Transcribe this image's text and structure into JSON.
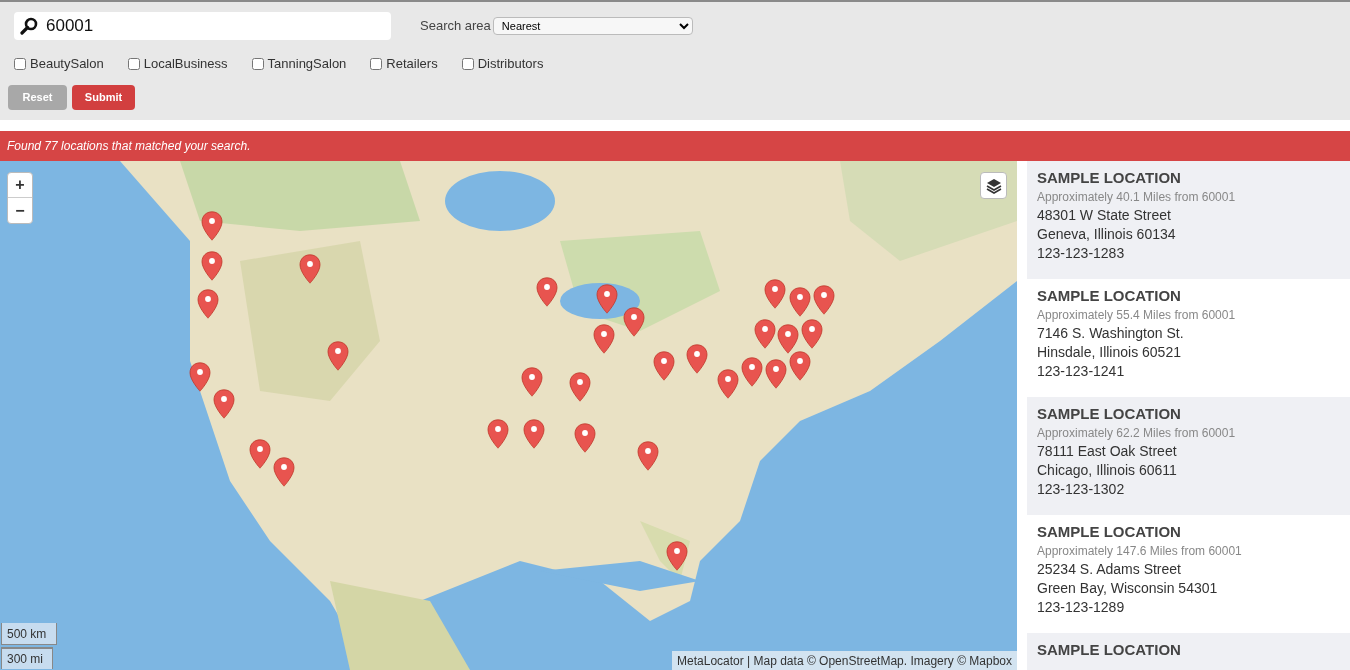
{
  "search": {
    "value": "60001"
  },
  "search_area": {
    "label": "Search area",
    "value": "Nearest"
  },
  "categories": [
    {
      "label": "BeautySalon",
      "checked": false
    },
    {
      "label": "LocalBusiness",
      "checked": false
    },
    {
      "label": "TanningSalon",
      "checked": false
    },
    {
      "label": "Retailers",
      "checked": false
    },
    {
      "label": "Distributors",
      "checked": false
    }
  ],
  "buttons": [
    {
      "label": "Reset",
      "kind": "secondary"
    },
    {
      "label": "Submit",
      "kind": "primary"
    }
  ],
  "result_banner": "Found 77 locations that matched your search.",
  "map": {
    "zoom_in": "+",
    "zoom_out": "−",
    "scale": [
      "500 km",
      "300 mi"
    ],
    "attribution": "MetaLocator | Map data © OpenStreetMap. Imagery © Mapbox"
  },
  "locations": [
    {
      "name": "SAMPLE LOCATION",
      "distance": "Approximately 40.1 Miles from 60001",
      "street": "48301 W State Street",
      "city": "Geneva, Illinois 60134",
      "phone": "123-123-1283"
    },
    {
      "name": "SAMPLE LOCATION",
      "distance": "Approximately 55.4 Miles from 60001",
      "street": "7146 S. Washington St.",
      "city": "Hinsdale, Illinois 60521",
      "phone": "123-123-1241"
    },
    {
      "name": "SAMPLE LOCATION",
      "distance": "Approximately 62.2 Miles from 60001",
      "street": "78111 East Oak Street",
      "city": "Chicago, Illinois 60611",
      "phone": "123-123-1302"
    },
    {
      "name": "SAMPLE LOCATION",
      "distance": "Approximately 147.6 Miles from 60001",
      "street": "25234 S. Adams Street",
      "city": "Green Bay, Wisconsin 54301",
      "phone": "123-123-1289"
    },
    {
      "name": "SAMPLE LOCATION"
    }
  ]
}
